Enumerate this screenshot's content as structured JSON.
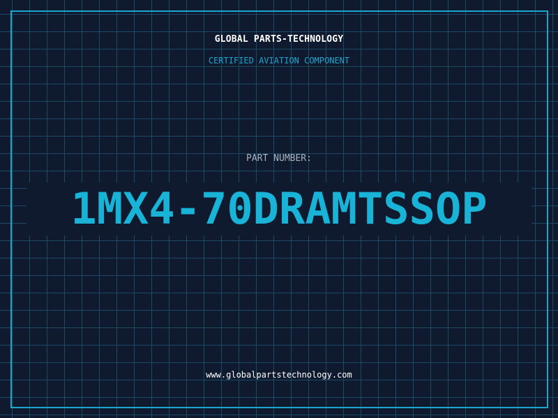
{
  "header": {
    "company": "GLOBAL PARTS-TECHNOLOGY",
    "certification": "CERTIFIED AVIATION COMPONENT"
  },
  "part": {
    "label": "PART NUMBER:",
    "number": "1MX4-70DRAMTSSOP"
  },
  "footer": {
    "website": "www.globalpartstechnology.com"
  },
  "colors": {
    "background": "#0f1a2e",
    "grid": "#1d4a63",
    "accent": "#1ba6cf",
    "part_number": "#19b3d8",
    "label": "#a7b4c4",
    "text": "#ffffff"
  }
}
